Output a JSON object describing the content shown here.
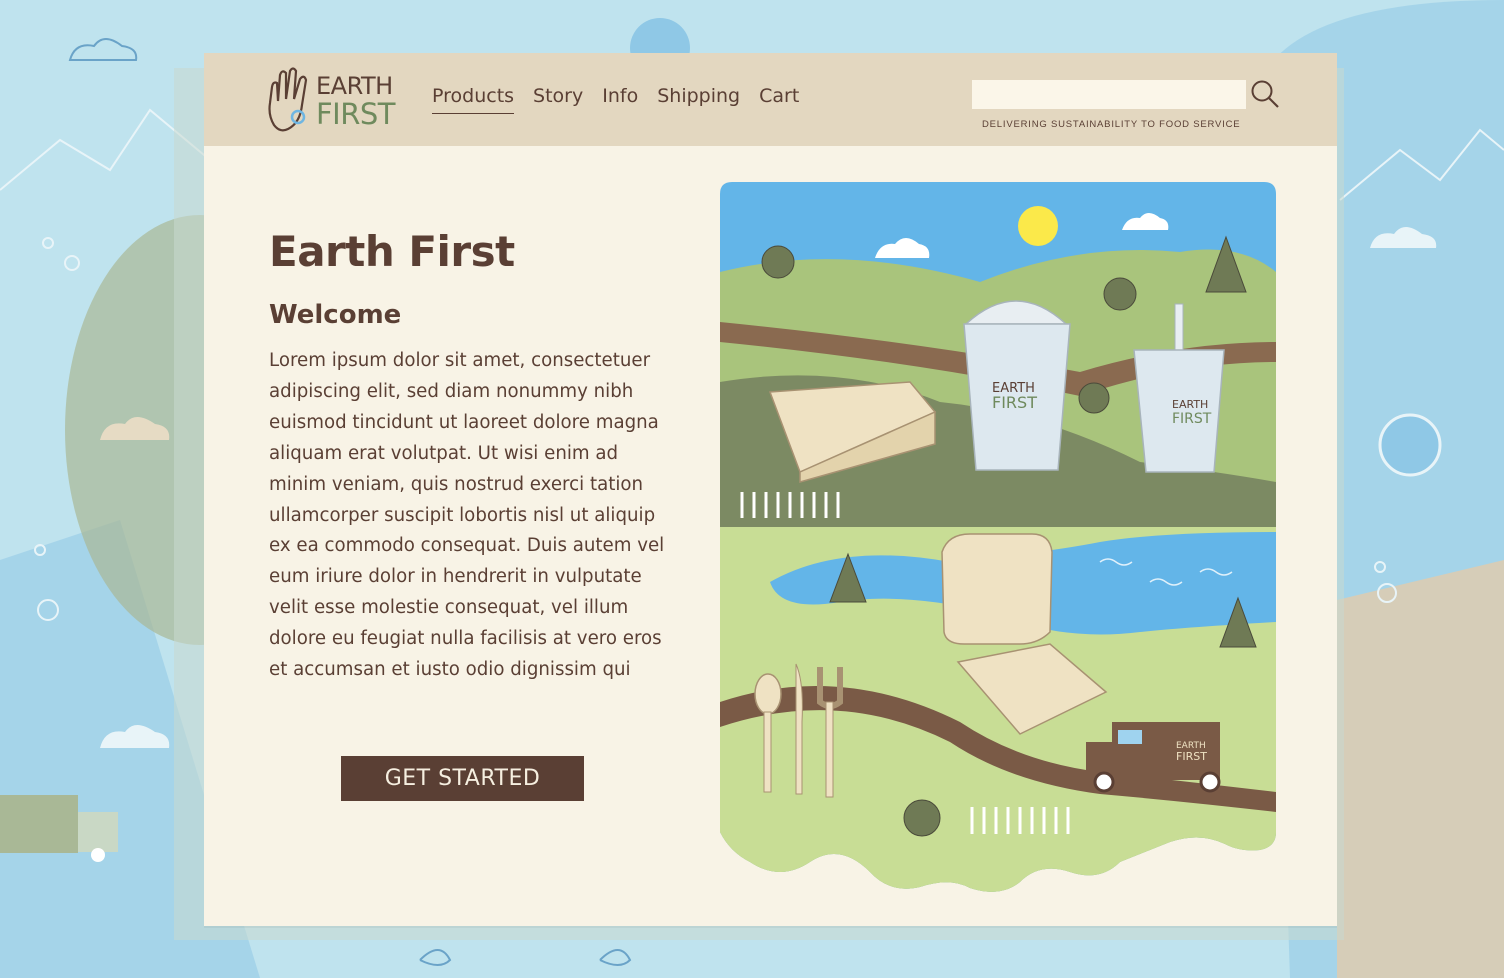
{
  "brand": {
    "logo_line1": "EARTH",
    "logo_line2": "FIRST",
    "tagline": "DELIVERING SUSTAINABILITY TO FOOD SERVICE"
  },
  "nav": {
    "items": [
      {
        "label": "Products",
        "active": true
      },
      {
        "label": "Story",
        "active": false
      },
      {
        "label": "Info",
        "active": false
      },
      {
        "label": "Shipping",
        "active": false
      },
      {
        "label": "Cart",
        "active": false
      }
    ]
  },
  "search": {
    "value": "",
    "placeholder": "",
    "icon": "search-icon"
  },
  "hero": {
    "title": "Earth First",
    "subtitle": "Welcome",
    "body": "Lorem ipsum dolor sit amet, consectetuer adipiscing elit, sed diam nonummy nibh euismod tincidunt ut laoreet dolore magna aliquam erat volutpat. Ut wisi enim ad minim veniam, quis nostrud exerci tation ullamcorper suscipit lobortis nisl ut aliquip ex ea commodo consequat. Duis autem vel eum iriure dolor in hendrerit in vulputate velit esse molestie consequat, vel illum dolore eu feugiat nulla facilisis at vero eros et accumsan et iusto odio dignissim qui",
    "cta_label": "GET STARTED"
  },
  "illustration": {
    "cup_label_1": "EARTH",
    "cup_label_2": "FIRST",
    "truck_label_1": "EARTH",
    "truck_label_2": "FIRST"
  },
  "colors": {
    "brand_brown": "#5a3f34",
    "brand_green": "#6f8a5d",
    "header_bg": "#e3d7c0",
    "page_bg": "#f8f3e6",
    "sky": "#bfe3ee"
  }
}
